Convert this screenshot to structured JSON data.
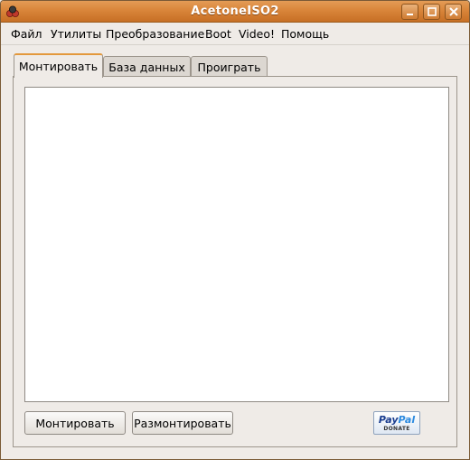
{
  "window": {
    "title": "AcetoneISO2",
    "controls": [
      "minimize-icon",
      "maximize-icon",
      "close-icon"
    ],
    "accent_color": "#d9853a"
  },
  "menu": {
    "items": [
      {
        "label": "Файл"
      },
      {
        "label": "Утилиты"
      },
      {
        "label": "Преобразование"
      },
      {
        "label": "Boot"
      },
      {
        "label": "Video!"
      },
      {
        "label": "Помощь"
      }
    ]
  },
  "tabs": [
    {
      "label": "Монтировать",
      "active": true
    },
    {
      "label": "База данных",
      "active": false
    },
    {
      "label": "Проиграть",
      "active": false
    }
  ],
  "mount_panel": {
    "list_items": [],
    "mount_button": "Монтировать",
    "unmount_button": "Размонтировать",
    "paypal": {
      "logo_text_pay": "Pay",
      "logo_text_pal": "Pal",
      "donate": "DONATE"
    }
  }
}
